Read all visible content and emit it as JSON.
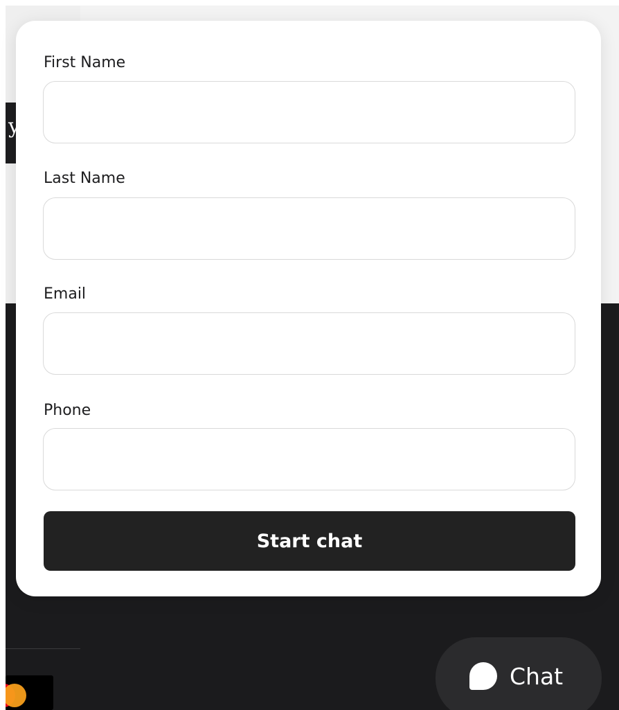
{
  "background": {
    "stripe_glyph": "y"
  },
  "form": {
    "fields": [
      {
        "label": "First Name",
        "value": "",
        "placeholder": ""
      },
      {
        "label": "Last Name",
        "value": "",
        "placeholder": ""
      },
      {
        "label": "Email",
        "value": "",
        "placeholder": ""
      },
      {
        "label": "Phone",
        "value": "",
        "placeholder": ""
      }
    ],
    "submit_label": "Start chat"
  },
  "launcher": {
    "label": "Chat",
    "icon": "chat-bubble-icon"
  },
  "colors": {
    "button_bg": "#222222",
    "footer_bg": "#1b1b1d",
    "launcher_bg": "#2b2b2d"
  }
}
